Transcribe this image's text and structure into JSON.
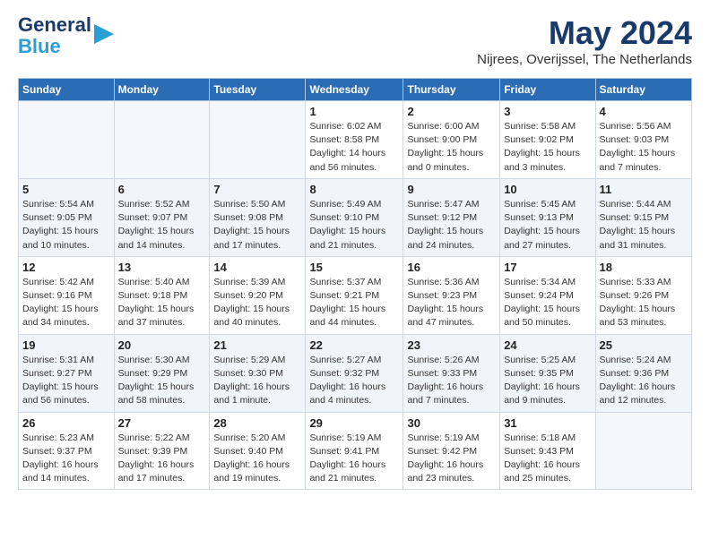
{
  "header": {
    "logo_line1": "General",
    "logo_line2": "Blue",
    "month_title": "May 2024",
    "location": "Nijrees, Overijssel, The Netherlands"
  },
  "days_of_week": [
    "Sunday",
    "Monday",
    "Tuesday",
    "Wednesday",
    "Thursday",
    "Friday",
    "Saturday"
  ],
  "weeks": [
    [
      {
        "day": "",
        "info": ""
      },
      {
        "day": "",
        "info": ""
      },
      {
        "day": "",
        "info": ""
      },
      {
        "day": "1",
        "info": "Sunrise: 6:02 AM\nSunset: 8:58 PM\nDaylight: 14 hours\nand 56 minutes."
      },
      {
        "day": "2",
        "info": "Sunrise: 6:00 AM\nSunset: 9:00 PM\nDaylight: 15 hours\nand 0 minutes."
      },
      {
        "day": "3",
        "info": "Sunrise: 5:58 AM\nSunset: 9:02 PM\nDaylight: 15 hours\nand 3 minutes."
      },
      {
        "day": "4",
        "info": "Sunrise: 5:56 AM\nSunset: 9:03 PM\nDaylight: 15 hours\nand 7 minutes."
      }
    ],
    [
      {
        "day": "5",
        "info": "Sunrise: 5:54 AM\nSunset: 9:05 PM\nDaylight: 15 hours\nand 10 minutes."
      },
      {
        "day": "6",
        "info": "Sunrise: 5:52 AM\nSunset: 9:07 PM\nDaylight: 15 hours\nand 14 minutes."
      },
      {
        "day": "7",
        "info": "Sunrise: 5:50 AM\nSunset: 9:08 PM\nDaylight: 15 hours\nand 17 minutes."
      },
      {
        "day": "8",
        "info": "Sunrise: 5:49 AM\nSunset: 9:10 PM\nDaylight: 15 hours\nand 21 minutes."
      },
      {
        "day": "9",
        "info": "Sunrise: 5:47 AM\nSunset: 9:12 PM\nDaylight: 15 hours\nand 24 minutes."
      },
      {
        "day": "10",
        "info": "Sunrise: 5:45 AM\nSunset: 9:13 PM\nDaylight: 15 hours\nand 27 minutes."
      },
      {
        "day": "11",
        "info": "Sunrise: 5:44 AM\nSunset: 9:15 PM\nDaylight: 15 hours\nand 31 minutes."
      }
    ],
    [
      {
        "day": "12",
        "info": "Sunrise: 5:42 AM\nSunset: 9:16 PM\nDaylight: 15 hours\nand 34 minutes."
      },
      {
        "day": "13",
        "info": "Sunrise: 5:40 AM\nSunset: 9:18 PM\nDaylight: 15 hours\nand 37 minutes."
      },
      {
        "day": "14",
        "info": "Sunrise: 5:39 AM\nSunset: 9:20 PM\nDaylight: 15 hours\nand 40 minutes."
      },
      {
        "day": "15",
        "info": "Sunrise: 5:37 AM\nSunset: 9:21 PM\nDaylight: 15 hours\nand 44 minutes."
      },
      {
        "day": "16",
        "info": "Sunrise: 5:36 AM\nSunset: 9:23 PM\nDaylight: 15 hours\nand 47 minutes."
      },
      {
        "day": "17",
        "info": "Sunrise: 5:34 AM\nSunset: 9:24 PM\nDaylight: 15 hours\nand 50 minutes."
      },
      {
        "day": "18",
        "info": "Sunrise: 5:33 AM\nSunset: 9:26 PM\nDaylight: 15 hours\nand 53 minutes."
      }
    ],
    [
      {
        "day": "19",
        "info": "Sunrise: 5:31 AM\nSunset: 9:27 PM\nDaylight: 15 hours\nand 56 minutes."
      },
      {
        "day": "20",
        "info": "Sunrise: 5:30 AM\nSunset: 9:29 PM\nDaylight: 15 hours\nand 58 minutes."
      },
      {
        "day": "21",
        "info": "Sunrise: 5:29 AM\nSunset: 9:30 PM\nDaylight: 16 hours\nand 1 minute."
      },
      {
        "day": "22",
        "info": "Sunrise: 5:27 AM\nSunset: 9:32 PM\nDaylight: 16 hours\nand 4 minutes."
      },
      {
        "day": "23",
        "info": "Sunrise: 5:26 AM\nSunset: 9:33 PM\nDaylight: 16 hours\nand 7 minutes."
      },
      {
        "day": "24",
        "info": "Sunrise: 5:25 AM\nSunset: 9:35 PM\nDaylight: 16 hours\nand 9 minutes."
      },
      {
        "day": "25",
        "info": "Sunrise: 5:24 AM\nSunset: 9:36 PM\nDaylight: 16 hours\nand 12 minutes."
      }
    ],
    [
      {
        "day": "26",
        "info": "Sunrise: 5:23 AM\nSunset: 9:37 PM\nDaylight: 16 hours\nand 14 minutes."
      },
      {
        "day": "27",
        "info": "Sunrise: 5:22 AM\nSunset: 9:39 PM\nDaylight: 16 hours\nand 17 minutes."
      },
      {
        "day": "28",
        "info": "Sunrise: 5:20 AM\nSunset: 9:40 PM\nDaylight: 16 hours\nand 19 minutes."
      },
      {
        "day": "29",
        "info": "Sunrise: 5:19 AM\nSunset: 9:41 PM\nDaylight: 16 hours\nand 21 minutes."
      },
      {
        "day": "30",
        "info": "Sunrise: 5:19 AM\nSunset: 9:42 PM\nDaylight: 16 hours\nand 23 minutes."
      },
      {
        "day": "31",
        "info": "Sunrise: 5:18 AM\nSunset: 9:43 PM\nDaylight: 16 hours\nand 25 minutes."
      },
      {
        "day": "",
        "info": ""
      }
    ]
  ]
}
